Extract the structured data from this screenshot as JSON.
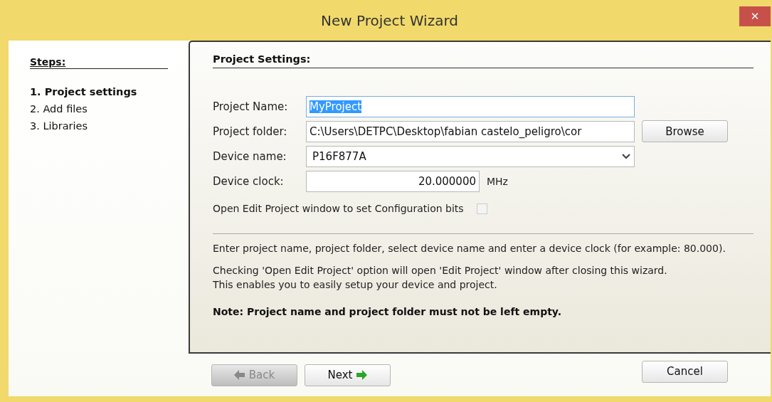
{
  "window": {
    "title": "New Project Wizard",
    "close": "✕"
  },
  "steps": {
    "title": "Steps:",
    "items": [
      {
        "label": "1. Project settings",
        "selected": true
      },
      {
        "label": "2. Add files",
        "selected": false
      },
      {
        "label": "3. Libraries",
        "selected": false
      }
    ]
  },
  "settings": {
    "title": "Project Settings:",
    "fields": [
      {
        "kind": "text",
        "label": "Project Name:",
        "value": "MyProject",
        "selected": true
      },
      {
        "kind": "browse",
        "label": "Project folder:",
        "value": "C:\\Users\\DETPC\\Desktop\\fabian castelo_peligro\\cor",
        "button": "Browse"
      },
      {
        "kind": "dropdown",
        "label": "Device name:",
        "value": "P16F877A"
      },
      {
        "kind": "number",
        "label": "Device clock:",
        "value": "20.000000",
        "unit": "MHz"
      }
    ],
    "option": {
      "label": "Open Edit Project window to set Configuration bits",
      "checked": false
    },
    "help": [
      "Enter project name, project folder, select device name and enter a device clock (for example: 80.000).",
      "Checking 'Open Edit Project' option will open 'Edit Project' window after closing this wizard.\nThis enables you to easily setup your device and project."
    ],
    "note": "Note: Project name and project folder must not be left empty."
  },
  "buttons": [
    {
      "kind": "back",
      "label": "Back",
      "disabled": true
    },
    {
      "kind": "next",
      "label": "Next",
      "disabled": false
    },
    {
      "kind": "cancel",
      "label": "Cancel",
      "disabled": false
    }
  ]
}
